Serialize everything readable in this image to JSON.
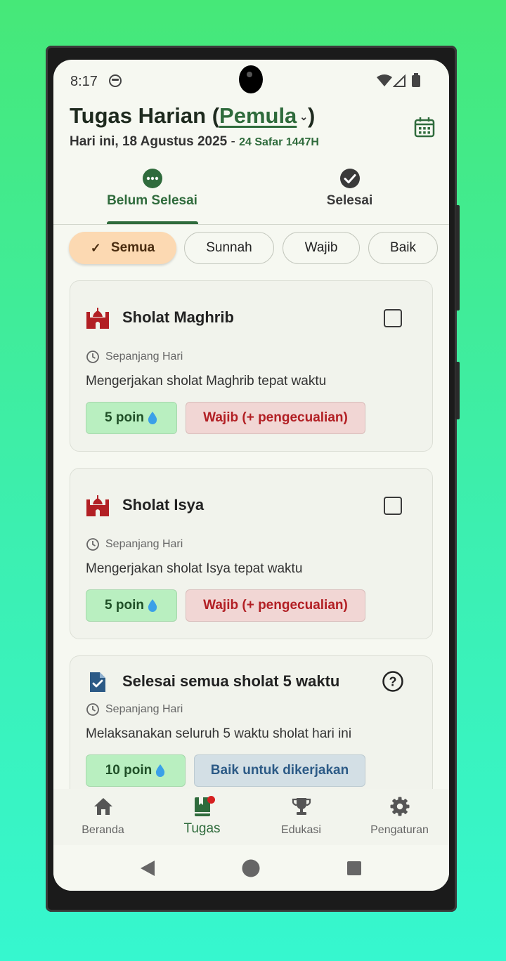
{
  "status": {
    "time": "8:17"
  },
  "header": {
    "title_prefix": "Tugas Harian (",
    "level": "Pemula",
    "title_suffix": ")",
    "date": "Hari ini, 18 Agustus 2025",
    "separator": " - ",
    "hijri": "24 Safar 1447H"
  },
  "tabs": [
    {
      "label": "Belum Selesai",
      "icon": "more-circle-icon",
      "active": true
    },
    {
      "label": "Selesai",
      "icon": "check-circle-icon",
      "active": false
    }
  ],
  "filters": [
    {
      "label": "Semua",
      "selected": true
    },
    {
      "label": "Sunnah",
      "selected": false
    },
    {
      "label": "Wajib",
      "selected": false
    },
    {
      "label": "Baik",
      "selected": false
    }
  ],
  "tasks": [
    {
      "title": "Sholat Maghrib",
      "icon": "mosque-icon",
      "time": "Sepanjang Hari",
      "description": "Mengerjakan sholat Maghrib tepat waktu",
      "points": "5 poin",
      "category": "Wajib (+ pengecualian)",
      "action": "checkbox"
    },
    {
      "title": "Sholat Isya",
      "icon": "mosque-icon",
      "time": "Sepanjang Hari",
      "description": "Mengerjakan sholat Isya tepat waktu",
      "points": "5 poin",
      "category": "Wajib (+ pengecualian)",
      "action": "checkbox"
    },
    {
      "title": "Selesai semua sholat 5 waktu",
      "icon": "task-document-icon",
      "time": "Sepanjang Hari",
      "description": "Melaksanakan seluruh 5 waktu sholat hari ini",
      "points": "10 poin",
      "category": "Baik untuk dikerjakan",
      "action": "help"
    }
  ],
  "points_icon": "water-drop",
  "bottom_nav": [
    {
      "label": "Beranda",
      "icon": "home-icon",
      "active": false
    },
    {
      "label": "Tugas",
      "icon": "book-icon",
      "active": true
    },
    {
      "label": "Edukasi",
      "icon": "trophy-icon",
      "active": false
    },
    {
      "label": "Pengaturan",
      "icon": "gear-icon",
      "active": false
    }
  ],
  "colors": {
    "primary": "#2f6b3c",
    "chip_selected": "#fcd9b2",
    "wajib_text": "#b21f24",
    "baik_text": "#2c5a86",
    "points_bg": "#b9efc0"
  }
}
